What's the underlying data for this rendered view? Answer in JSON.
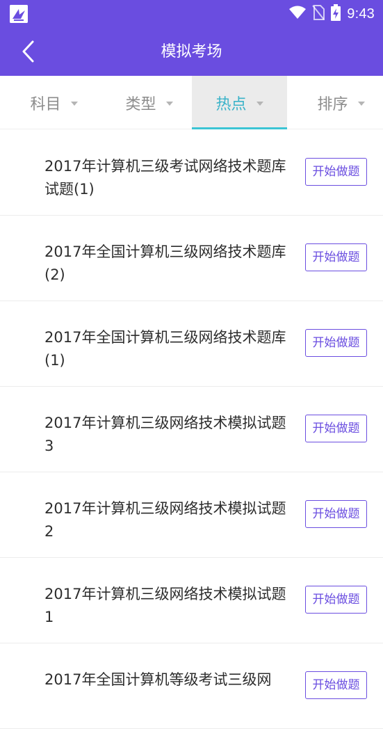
{
  "status_bar": {
    "time": "9:43",
    "icons": [
      "app-icon",
      "wifi-icon",
      "no-sim-icon",
      "battery-charging-icon"
    ]
  },
  "app_bar": {
    "title": "模拟考场",
    "back_icon": "chevron-left-icon"
  },
  "filters": {
    "tabs": [
      {
        "label": "科目",
        "active": false
      },
      {
        "label": "类型",
        "active": false
      },
      {
        "label": "热点",
        "active": true
      },
      {
        "label": "排序",
        "active": false
      }
    ]
  },
  "list": {
    "button_label": "开始做题",
    "items": [
      {
        "title": "2017年计算机三级考试网络技术题库试题(1)"
      },
      {
        "title": "2017年全国计算机三级网络技术题库(2)"
      },
      {
        "title": "2017年全国计算机三级网络技术题库(1)"
      },
      {
        "title": "2017年计算机三级网络技术模拟试题3"
      },
      {
        "title": "2017年计算机三级网络技术模拟试题2"
      },
      {
        "title": "2017年计算机三级网络技术模拟试题1"
      },
      {
        "title": "2017年全国计算机等级考试三级网"
      }
    ]
  },
  "colors": {
    "primary": "#6a4de0",
    "tab_active_text": "#3bb3c9",
    "tab_underline": "#3bc4d4",
    "tab_active_bg": "#ebebeb"
  }
}
